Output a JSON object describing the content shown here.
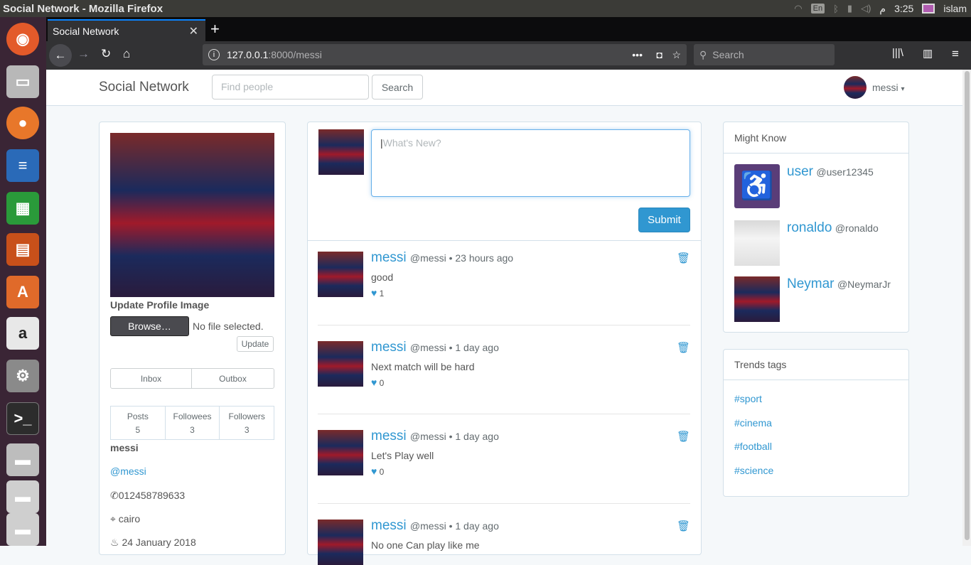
{
  "os": {
    "window_title": "Social Network - Mozilla Firefox",
    "time": "3:25",
    "am_pm": "م",
    "lang": "En",
    "user": "islam"
  },
  "browser": {
    "tab_title": "Social Network",
    "url_host": "127.0.0.1",
    "url_rest": ":8000/messi",
    "search_placeholder": "Search"
  },
  "nav": {
    "brand": "Social Network",
    "find_placeholder": "Find people",
    "search_label": "Search",
    "username": "messi"
  },
  "profile": {
    "update_image_label": "Update Profile Image",
    "browse_label": "Browse…",
    "no_file": "No file selected.",
    "update_label": "Update",
    "inbox": "Inbox",
    "outbox": "Outbox",
    "stats": [
      {
        "label": "Posts",
        "value": "5"
      },
      {
        "label": "Followees",
        "value": "3"
      },
      {
        "label": "Followers",
        "value": "3"
      }
    ],
    "name": "messi",
    "handle": "@messi",
    "phone": "012458789633",
    "city": "cairo",
    "joined": "24 January 2018"
  },
  "composer": {
    "placeholder": "What's New?",
    "submit": "Submit"
  },
  "posts": [
    {
      "author": "messi",
      "meta": "@messi • 23 hours ago",
      "body": "good",
      "likes": "1"
    },
    {
      "author": "messi",
      "meta": "@messi • 1 day ago",
      "body": "Next match will be hard",
      "likes": "0"
    },
    {
      "author": "messi",
      "meta": "@messi • 1 day ago",
      "body": "Let's Play well",
      "likes": "0"
    },
    {
      "author": "messi",
      "meta": "@messi • 1 day ago",
      "body": "No one Can play like me",
      "likes": ""
    }
  ],
  "might_know": {
    "title": "Might Know",
    "people": [
      {
        "name": "user",
        "handle": "@user12345"
      },
      {
        "name": "ronaldo",
        "handle": "@ronaldo"
      },
      {
        "name": "Neymar",
        "handle": "@NeymarJr"
      }
    ]
  },
  "trends": {
    "title": "Trends tags",
    "tags": [
      "#sport",
      "#cinema",
      "#football",
      "#science"
    ]
  },
  "colors": {
    "accent": "#3097d1",
    "submit_bg": "#3097d1"
  }
}
